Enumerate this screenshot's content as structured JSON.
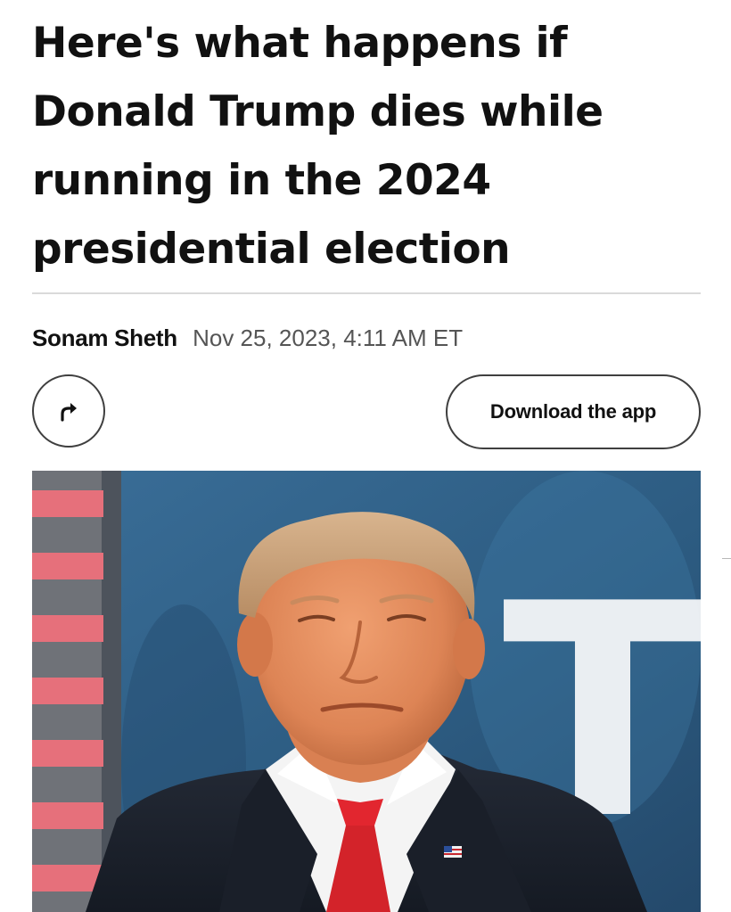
{
  "article": {
    "headline_lines": [
      "Here's what happens if",
      "Donald Trump dies while",
      "running in the 2024",
      "presidential election"
    ],
    "author": "Sonam Sheth",
    "date": "Nov 25, 2023, 4:11 AM ET"
  },
  "actions": {
    "share_icon": "share-arrow-icon",
    "download_label": "Download the app"
  },
  "photo": {
    "backdrop_letter": "T"
  },
  "colors": {
    "text": "#111111",
    "muted": "#555555",
    "divider": "#dadada",
    "button_border": "#3f3f3f",
    "photo_background": "#2f5f86",
    "tie": "#d3232a"
  }
}
